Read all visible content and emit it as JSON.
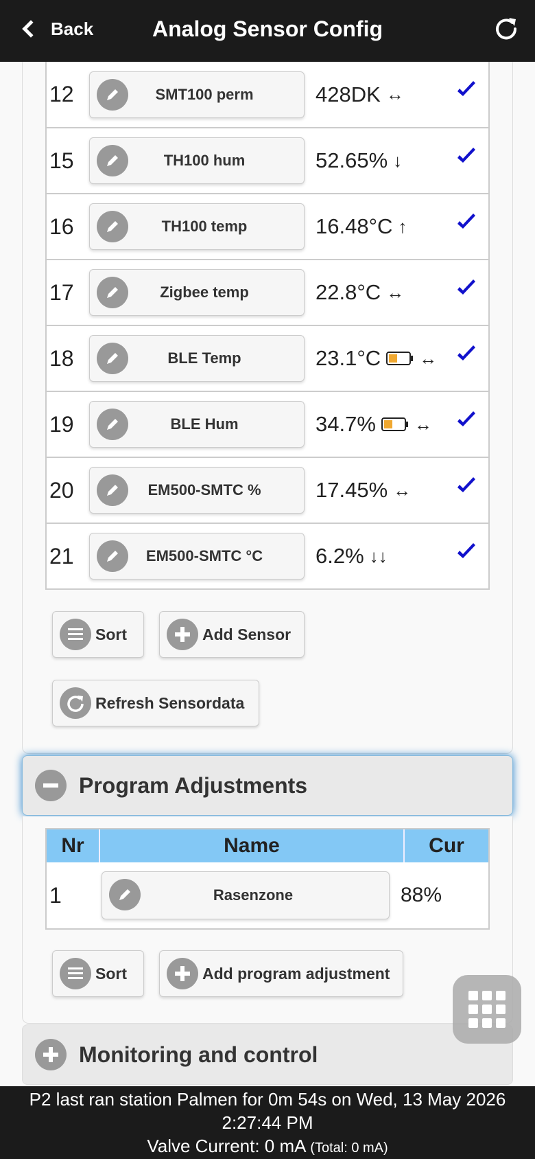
{
  "header": {
    "back_label": "Back",
    "title": "Analog Sensor Config"
  },
  "sensors": [
    {
      "nr": "12",
      "name": "SMT100 perm",
      "value": "428DK",
      "battery": false,
      "trend": "↔"
    },
    {
      "nr": "15",
      "name": "TH100 hum",
      "value": "52.65%",
      "battery": false,
      "trend": "↓"
    },
    {
      "nr": "16",
      "name": "TH100 temp",
      "value": "16.48°C",
      "battery": false,
      "trend": "↑"
    },
    {
      "nr": "17",
      "name": "Zigbee temp",
      "value": "22.8°C",
      "battery": false,
      "trend": "↔"
    },
    {
      "nr": "18",
      "name": "BLE Temp",
      "value": "23.1°C",
      "battery": true,
      "trend": "↔"
    },
    {
      "nr": "19",
      "name": "BLE Hum",
      "value": "34.7%",
      "battery": true,
      "trend": "↔"
    },
    {
      "nr": "20",
      "name": "EM500-SMTC %",
      "value": "17.45%",
      "battery": false,
      "trend": "↔"
    },
    {
      "nr": "21",
      "name": "EM500-SMTC °C",
      "value": "6.2%",
      "battery": false,
      "trend": "↓↓"
    }
  ],
  "sensor_actions": {
    "sort_label": "Sort",
    "add_label": "Add Sensor",
    "refresh_label": "Refresh Sensordata"
  },
  "program_adjustments": {
    "heading": "Program Adjustments",
    "columns": [
      "Nr",
      "Name",
      "Cur"
    ],
    "rows": [
      {
        "nr": "1",
        "name": "Rasenzone",
        "cur": "88%"
      }
    ],
    "sort_label": "Sort",
    "add_label": "Add program adjustment"
  },
  "monitoring": {
    "heading": "Monitoring and control"
  },
  "footer": {
    "status_line1": "P2 last ran station Palmen for 0m 54s on Wed, 13 May 2026",
    "status_line2": "2:27:44 PM",
    "valve_current": "Valve Current: 0 mA",
    "valve_total": "(Total: 0 mA)"
  },
  "colors": {
    "header_bg": "#1b1b1b",
    "table_head_bg": "#83c8f5",
    "check_color": "#1111cc",
    "battery_fill": "#f0a830"
  }
}
